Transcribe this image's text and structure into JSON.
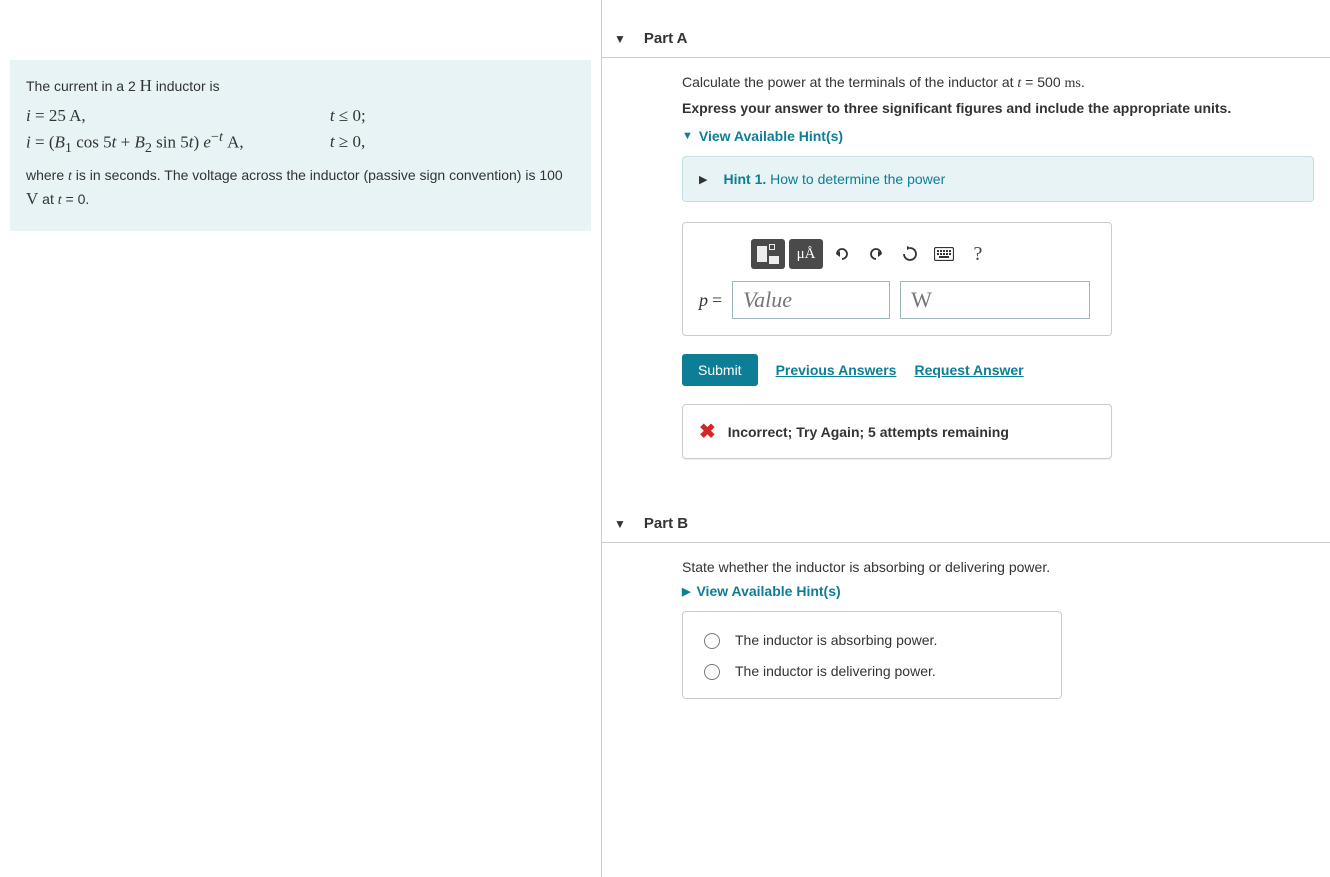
{
  "problem": {
    "intro": "The current in a 2 H inductor is",
    "eq1_lhs": "i = 25 A,",
    "eq1_rhs": "t ≤ 0;",
    "eq2_lhs_html": "i = (B₁ cos 5t + B₂ sin 5t) e⁻ᵗ A,",
    "eq2_rhs": "t ≥ 0,",
    "footer": "where t is in seconds. The voltage across the inductor (passive sign convention) is 100 V at t = 0."
  },
  "partA": {
    "header": "Part A",
    "prompt": "Calculate the power at the terminals of the inductor at t = 500 ms.",
    "instructions": "Express your answer to three significant figures and include the appropriate units.",
    "hints_link": "View Available Hint(s)",
    "hint1_label": "Hint 1.",
    "hint1_text": " How to determine the power",
    "variable": "p",
    "equals": "=",
    "value_placeholder": "Value",
    "unit_placeholder": "W",
    "submit": "Submit",
    "previous": "Previous Answers",
    "request": "Request Answer",
    "feedback": "Incorrect; Try Again; 5 attempts remaining",
    "tool_mu": "μÅ",
    "tool_help": "?"
  },
  "partB": {
    "header": "Part B",
    "prompt": "State whether the inductor is absorbing or delivering power.",
    "hints_link": "View Available Hint(s)",
    "opt1": "The inductor is absorbing power.",
    "opt2": "The inductor is delivering power."
  }
}
